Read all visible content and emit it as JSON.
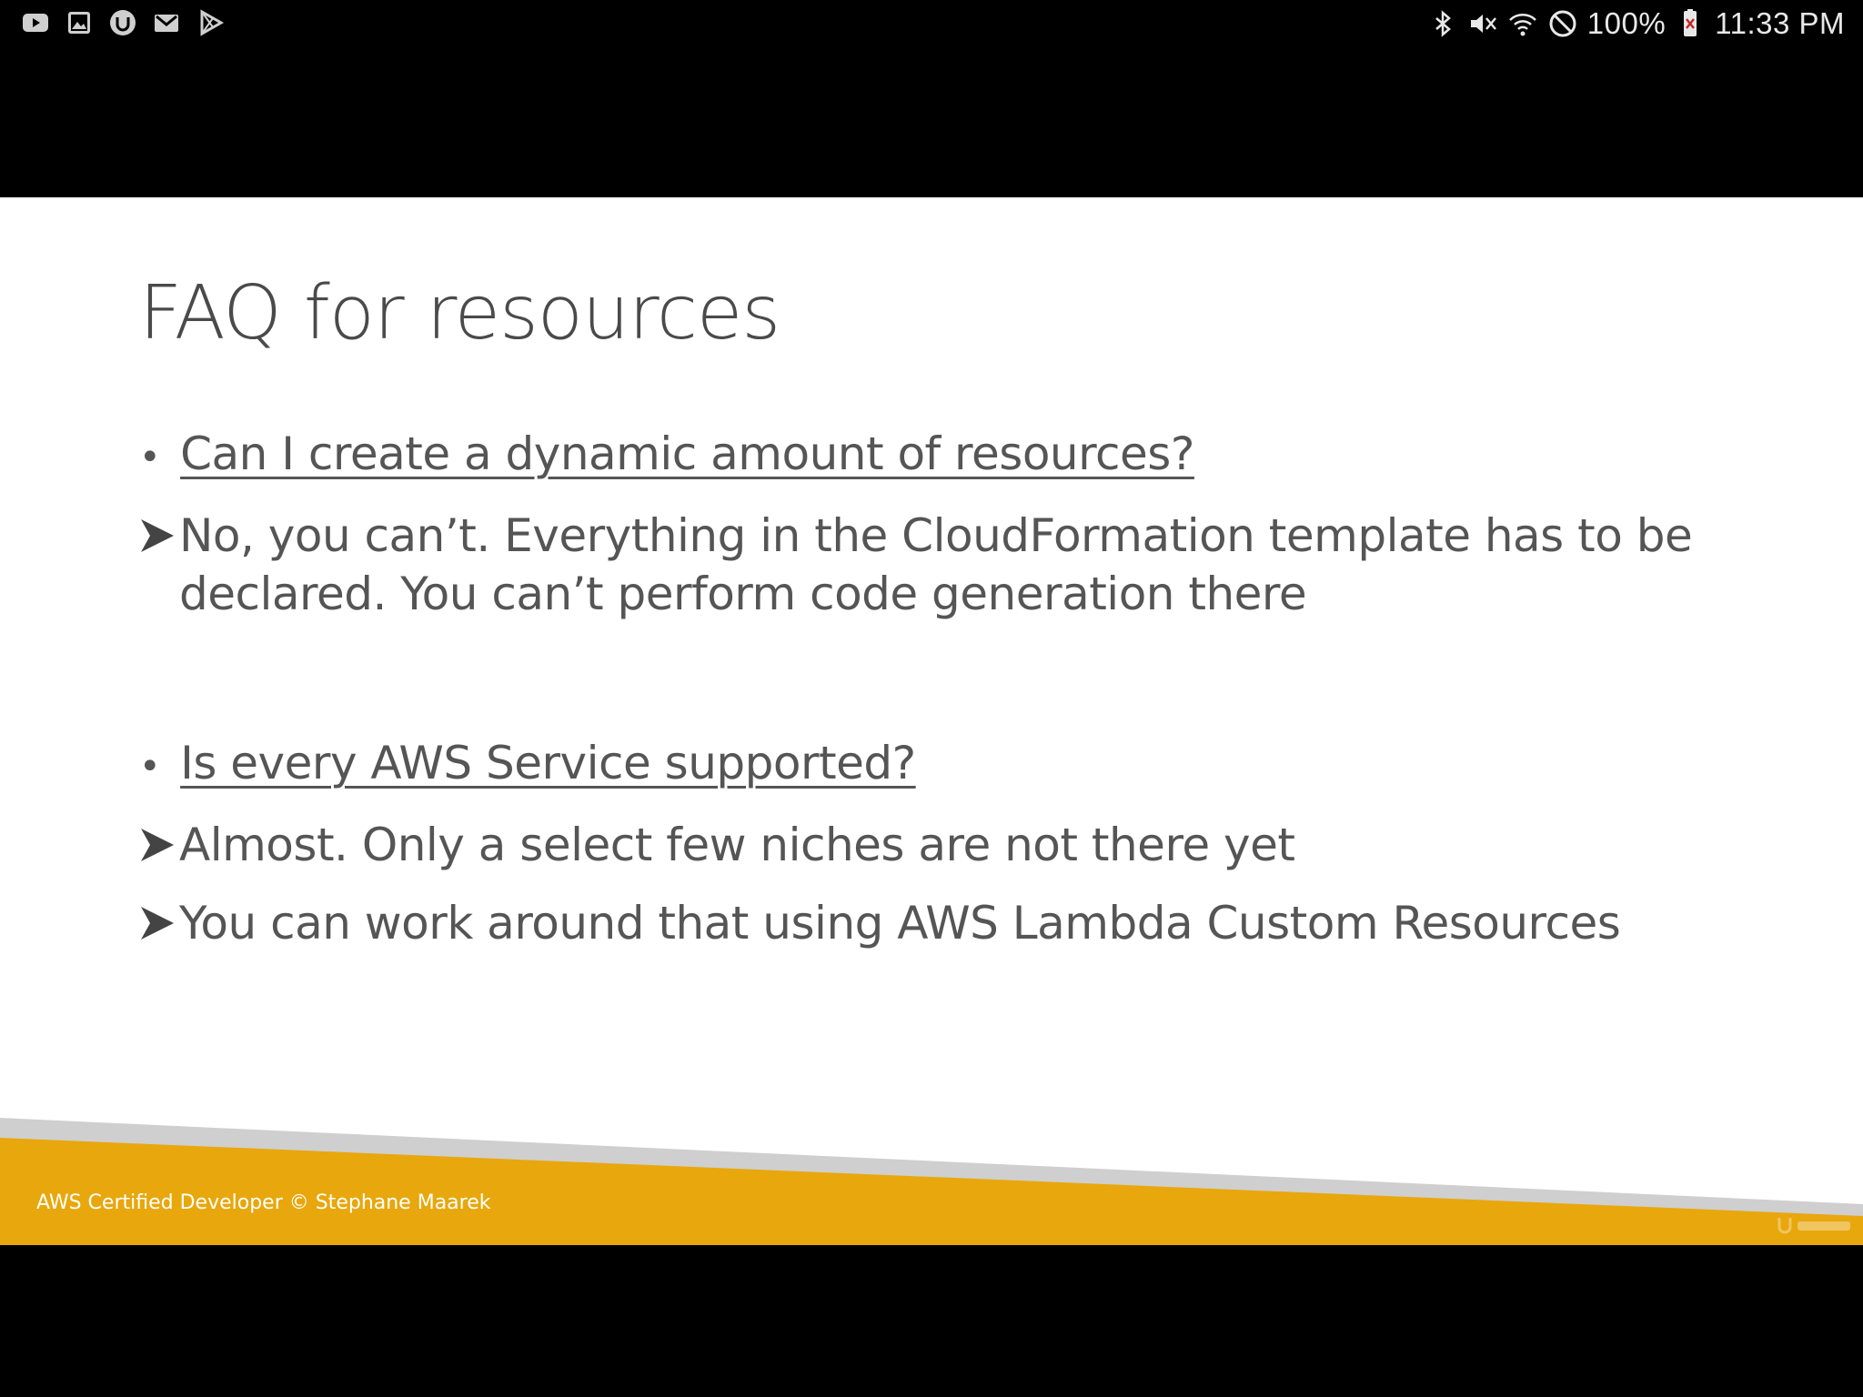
{
  "status_bar": {
    "left_icons": [
      "youtube-icon",
      "gallery-icon",
      "udemy-icon",
      "gmail-icon",
      "play-store-icon"
    ],
    "right_icons": [
      "bluetooth-icon",
      "mute-icon",
      "wifi-icon",
      "do-not-disturb-icon",
      "battery-icon"
    ],
    "battery_percent": "100%",
    "time": "11:33 PM"
  },
  "slide": {
    "title": "FAQ for resources",
    "items": [
      {
        "question": "Can I create a dynamic amount of resources?",
        "answers": [
          "No, you can’t. Everything in the CloudFormation template has to be declared. You can’t perform code generation there"
        ]
      },
      {
        "question": "Is every AWS Service supported?",
        "answers": [
          "Almost. Only a select few niches are not there yet",
          "You can work around that using AWS Lambda Custom Resources"
        ]
      }
    ],
    "footer": "AWS Certified Developer © Stephane Maarek",
    "watermark": "udemy-logo"
  },
  "colors": {
    "footer_band": "#E8A70C",
    "footer_gray": "#CFCFCF",
    "title": "#4A4A4A",
    "body": "#555555"
  }
}
